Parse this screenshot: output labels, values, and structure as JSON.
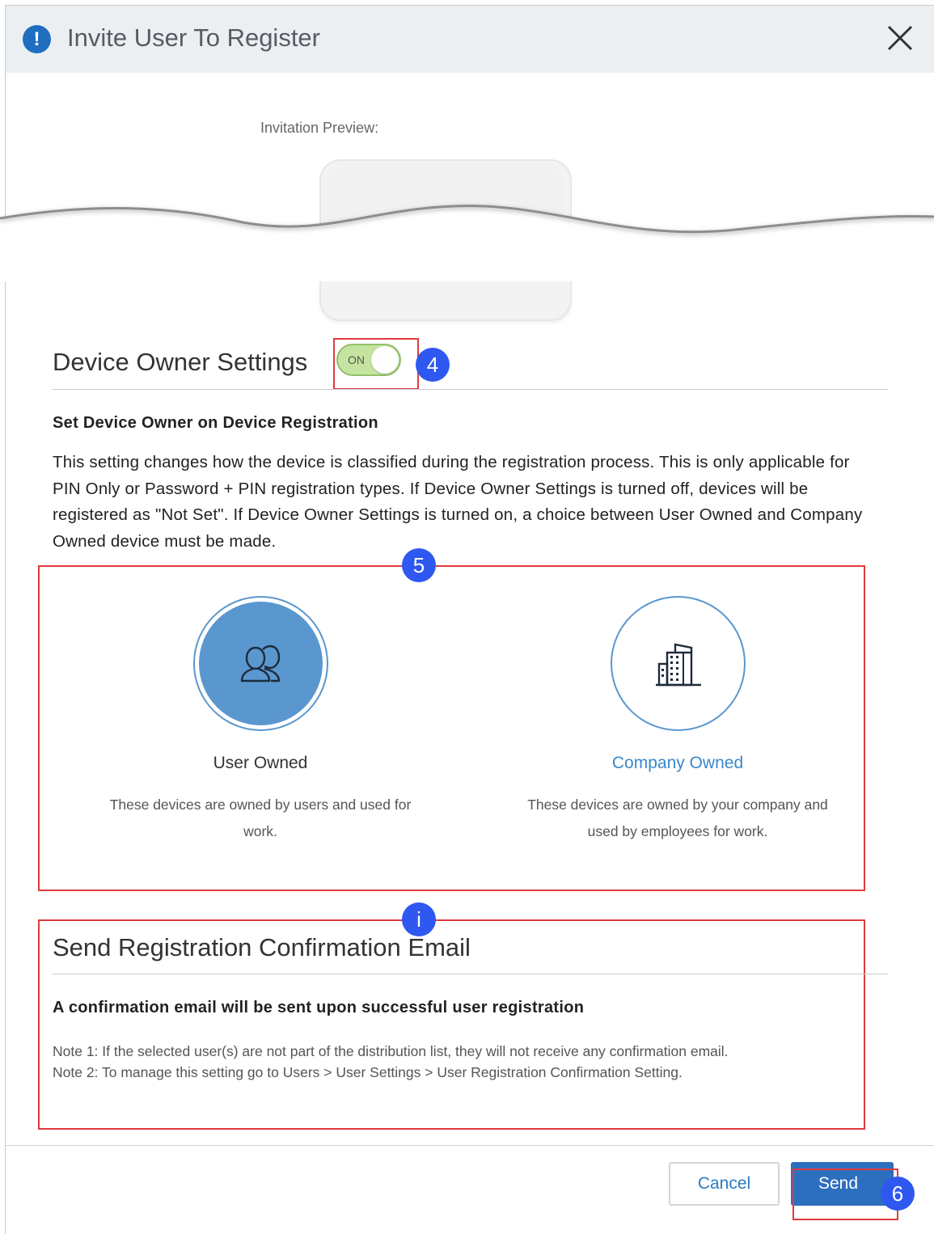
{
  "dialog": {
    "title": "Invite User To Register",
    "title_icon": "exclamation-info-icon",
    "close_icon": "close-x-icon"
  },
  "preview": {
    "label": "Invitation Preview:"
  },
  "device_owner": {
    "heading": "Device Owner Settings",
    "toggle_label": "ON",
    "toggle_state": "on",
    "subheading": "Set Device Owner on Device Registration",
    "description": "This setting changes how the device is classified during the registration process. This is only applicable for PIN Only or Password + PIN registration types. If Device Owner Settings is turned off, devices will be registered as \"Not Set\". If Device Owner Settings is turned on, a choice between User Owned and Company Owned device must be made.",
    "options": [
      {
        "label": "User Owned",
        "description": "These devices are owned by users and used for work.",
        "icon": "users-icon",
        "selected": true
      },
      {
        "label": "Company Owned",
        "description": "These devices are owned by your company and used by employees for work.",
        "icon": "building-icon",
        "selected": false
      }
    ]
  },
  "confirmation": {
    "heading": "Send Registration Confirmation Email",
    "subheading": "A confirmation email will be sent upon successful user registration",
    "note1": "Note 1: If the selected user(s) are not part of the distribution list, they will not receive any confirmation email.",
    "note2": "Note 2: To manage this setting go to Users > User Settings > User Registration Confirmation Setting."
  },
  "footer": {
    "cancel_label": "Cancel",
    "send_label": "Send"
  },
  "callouts": {
    "toggle": "4",
    "owner_options": "5",
    "confirmation": "i",
    "send": "6"
  },
  "colors": {
    "accent_blue": "#2d6fbf",
    "selected_circle": "#5a97cf",
    "toggle_on": "#c5e4a1",
    "callout": "#2f58f0",
    "highlight_red": "#e03a3e"
  }
}
